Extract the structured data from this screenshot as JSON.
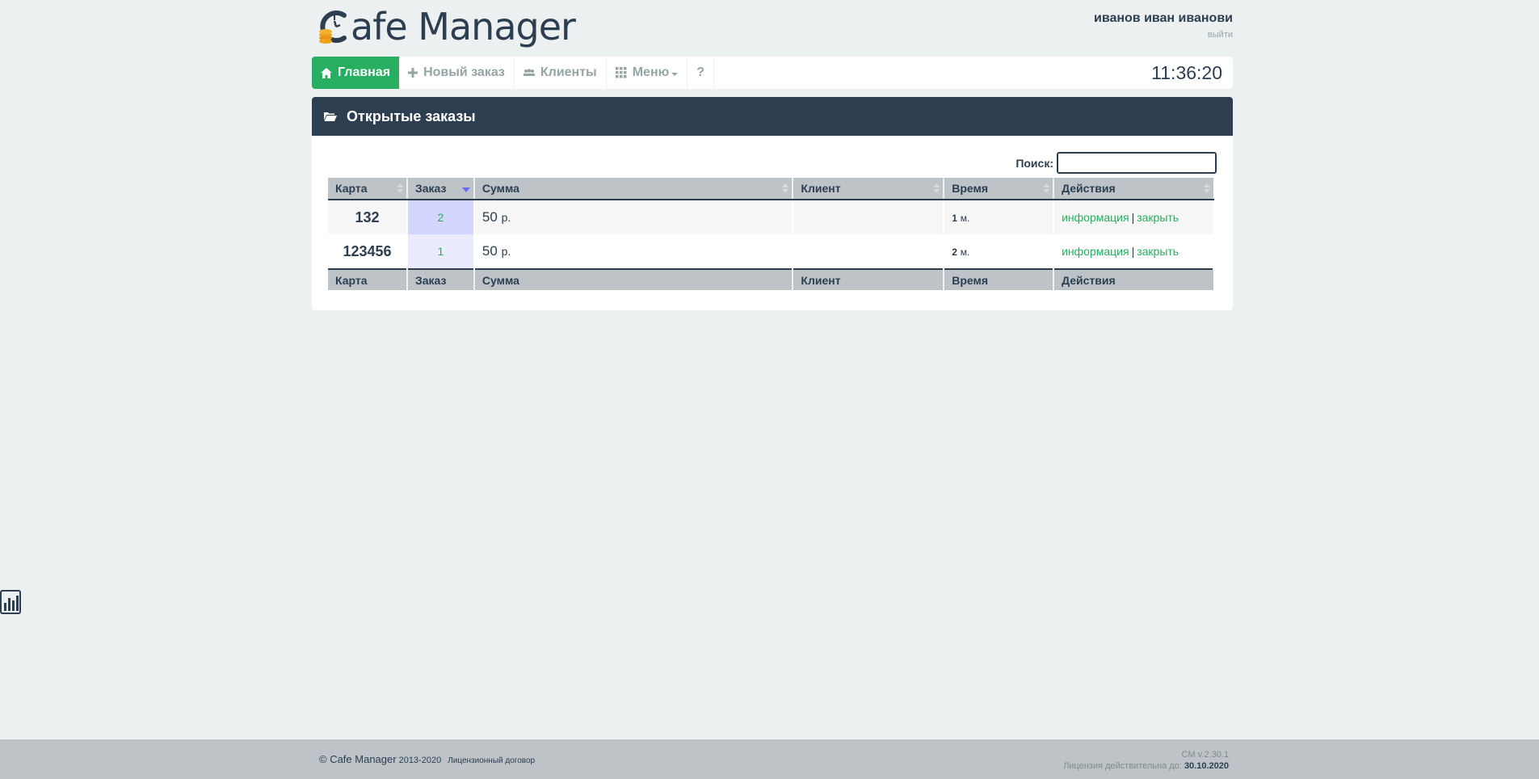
{
  "header": {
    "logo_text": "afe Manager",
    "user_name": "иванов иван иванови",
    "logout_label": "выйти"
  },
  "nav": {
    "items": [
      {
        "label": "Главная",
        "icon": "home-icon",
        "active": true
      },
      {
        "label": "Новый заказ",
        "icon": "plus-icon"
      },
      {
        "label": "Клиенты",
        "icon": "users-icon"
      },
      {
        "label": "Меню",
        "icon": "grid-icon",
        "dropdown": true
      },
      {
        "label": "?",
        "icon": ""
      }
    ],
    "clock": "11:36:20"
  },
  "panel": {
    "title": "Открытые заказы",
    "search_label": "Поиск:",
    "search_value": ""
  },
  "table": {
    "headers": [
      "Карта",
      "Заказ",
      "Сумма",
      "Клиент",
      "Время",
      "Действия"
    ],
    "rows": [
      {
        "card": "132",
        "order": "2",
        "sum": "50",
        "currency": "р.",
        "client": "",
        "time": "1",
        "time_unit": "м.",
        "info_label": "информация",
        "sep": "|",
        "close_label": "закрыть"
      },
      {
        "card": "123456",
        "order": "1",
        "sum": "50",
        "currency": "р.",
        "client": "",
        "time": "2",
        "time_unit": "м.",
        "info_label": "информация",
        "sep": "|",
        "close_label": "закрыть"
      }
    ]
  },
  "footer": {
    "copyright": "© Cafe Manager",
    "years": "2013-2020",
    "license_link": "Лицензионный договор",
    "version": "CM v.2.30.1",
    "license_label": "Лицензия действительна до:",
    "license_date": "30.10.2020"
  },
  "colors": {
    "background": "#ecf0f1",
    "primary": "#2c3e50",
    "accent": "#27ae60",
    "muted": "#95a5a6",
    "footer": "#bdc3c7",
    "logo_coins": "#f0a21b"
  }
}
